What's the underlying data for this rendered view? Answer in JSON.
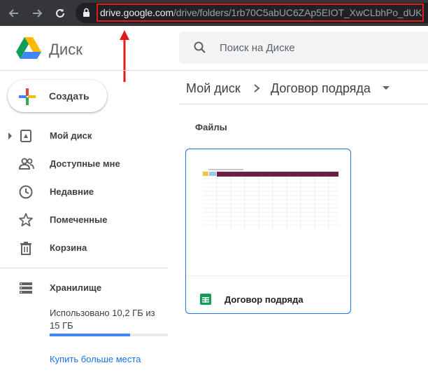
{
  "browser": {
    "url_host": "drive.google.com",
    "url_path": "/drive/folders/1rb70C5abUC6ZAp5EIOT_XwCLbhPo_dUK",
    "highlight_color": "#e01b1b"
  },
  "header": {
    "app_title": "Диск",
    "search_placeholder": "Поиск на Диске"
  },
  "sidebar": {
    "new_button": "Создать",
    "items": [
      {
        "label": "Мой диск",
        "icon": "my-drive-icon"
      },
      {
        "label": "Доступные мне",
        "icon": "shared-icon"
      },
      {
        "label": "Недавние",
        "icon": "clock-icon"
      },
      {
        "label": "Помеченные",
        "icon": "star-icon"
      },
      {
        "label": "Корзина",
        "icon": "trash-icon"
      }
    ],
    "storage": {
      "label": "Хранилище",
      "used_text": "Использовано 10,2 ГБ из 15 ГБ",
      "used_fraction": 0.68,
      "buy_more": "Купить больше места"
    }
  },
  "main": {
    "breadcrumb": [
      "Мой диск",
      "Договор подряда"
    ],
    "section_title": "Файлы",
    "files": [
      {
        "name": "Договор подряда",
        "type": "spreadsheet",
        "icon": "sheets-icon"
      }
    ]
  },
  "colors": {
    "accent": "#1a73e8",
    "sheets_green": "#0f9d58",
    "thumb_header": "#6b1f45"
  }
}
